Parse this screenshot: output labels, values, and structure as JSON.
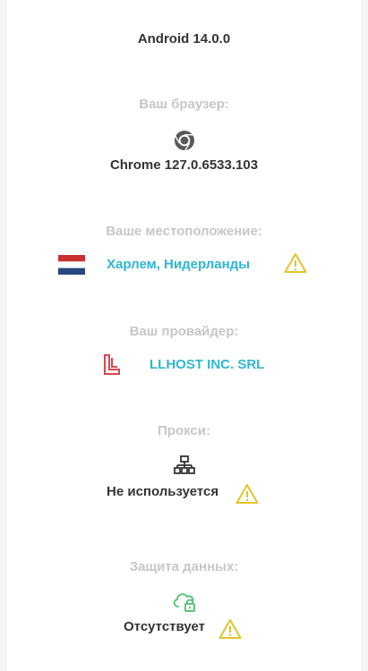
{
  "device": {
    "os": "Android 14.0.0"
  },
  "browser": {
    "label": "Ваш браузер:",
    "icon": "chrome-icon",
    "value": "Chrome 127.0.6533.103"
  },
  "location": {
    "label": "Ваше местоположение:",
    "icon": "netherlands-flag-icon",
    "value": "Харлем, Нидерланды",
    "status_icon": "warning-icon"
  },
  "provider": {
    "label": "Ваш провайдер:",
    "icon": "provider-logo-icon",
    "value": "LLHOST INC. SRL"
  },
  "proxy": {
    "label": "Прокси:",
    "icon": "network-icon",
    "value": "Не используется",
    "status_icon": "warning-icon"
  },
  "data_protection": {
    "label": "Защита данных:",
    "icon": "cloud-lock-icon",
    "value": "Отсутствует",
    "status_icon": "warning-icon"
  },
  "colors": {
    "label": "#c7c7c7",
    "value": "#333333",
    "link": "#2fb6d3",
    "warning": "#e2c429",
    "provider_logo": "#d8474b",
    "cloud_lock": "#5cc47a"
  }
}
